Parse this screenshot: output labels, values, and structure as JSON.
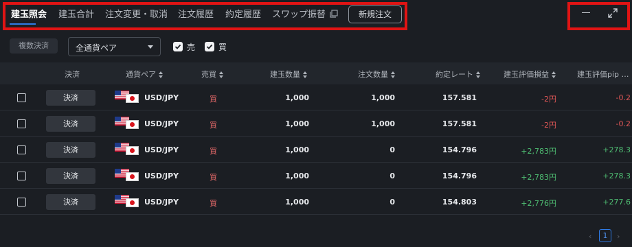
{
  "tabs": [
    {
      "label": "建玉照会",
      "active": true
    },
    {
      "label": "建玉合計"
    },
    {
      "label": "注文変更・取消"
    },
    {
      "label": "注文履歴"
    },
    {
      "label": "約定履歴"
    },
    {
      "label": "スワップ振替"
    }
  ],
  "new_order_label": "新規注文",
  "filters": {
    "bulk_settle_label": "複数決済",
    "pair_select_value": "全通貨ペア",
    "sell_label": "売",
    "buy_label": "買",
    "sell_checked": true,
    "buy_checked": true
  },
  "table": {
    "headers": [
      "決済",
      "通貨ペア",
      "売買",
      "建玉数量",
      "注文数量",
      "約定レート",
      "建玉評価損益",
      "建玉評価pip"
    ],
    "header_more": "…",
    "settle_button_label": "決済",
    "rows": [
      {
        "pair": "USD/JPY",
        "side": "買",
        "position_qty": "1,000",
        "order_qty": "1,000",
        "rate": "157.581",
        "pl": "-2円",
        "pl_pip": "-0.2"
      },
      {
        "pair": "USD/JPY",
        "side": "買",
        "position_qty": "1,000",
        "order_qty": "1,000",
        "rate": "157.581",
        "pl": "-2円",
        "pl_pip": "-0.2"
      },
      {
        "pair": "USD/JPY",
        "side": "買",
        "position_qty": "1,000",
        "order_qty": "0",
        "rate": "154.796",
        "pl": "+2,783円",
        "pl_pip": "+278.3"
      },
      {
        "pair": "USD/JPY",
        "side": "買",
        "position_qty": "1,000",
        "order_qty": "0",
        "rate": "154.796",
        "pl": "+2,783円",
        "pl_pip": "+278.3"
      },
      {
        "pair": "USD/JPY",
        "side": "買",
        "position_qty": "1,000",
        "order_qty": "0",
        "rate": "154.803",
        "pl": "+2,776円",
        "pl_pip": "+277.6"
      }
    ]
  },
  "pagination": {
    "prev": "‹",
    "current": "1",
    "next": "›"
  },
  "colors": {
    "accent": "#2f7be6",
    "highlight_frame": "#e01414",
    "negative": "#e05757",
    "positive": "#4fbf73",
    "buy": "#e86a6a"
  }
}
